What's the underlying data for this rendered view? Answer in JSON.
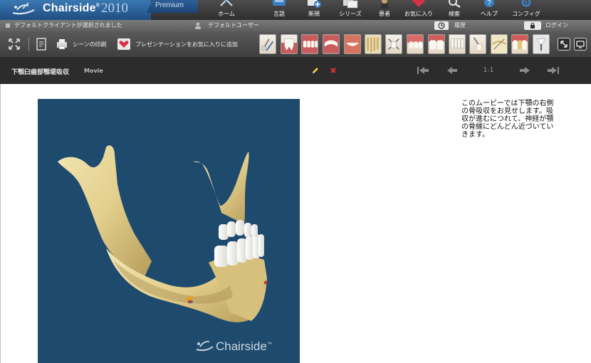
{
  "app": {
    "brand_name": "Chairside",
    "brand_mark": "®",
    "brand_year": "2010",
    "edition": "Premium",
    "nav": [
      {
        "label": "ホーム",
        "icon": "home-icon"
      },
      {
        "label": "言語",
        "icon": "language-icon"
      },
      {
        "label": "新規",
        "icon": "new-icon"
      },
      {
        "label": "シリーズ",
        "icon": "series-icon"
      },
      {
        "label": "患者",
        "icon": "patient-icon"
      },
      {
        "label": "お気に入り",
        "icon": "favorites-icon"
      },
      {
        "label": "検索",
        "icon": "search-icon"
      },
      {
        "label": "ヘルプ",
        "icon": "help-icon"
      },
      {
        "label": "コンフィグ",
        "icon": "config-icon"
      }
    ]
  },
  "status": {
    "client": "デフォルトクライアントが選択されました",
    "user": "デフォルトユーザー",
    "history": "履歴",
    "login": "ログイン"
  },
  "toolbar": {
    "print_label": "シーンの印刷",
    "favorite_label": "プレゼンテーションをお気に入りに追加"
  },
  "scene": {
    "title": "下顎臼歯部顎堤吸収",
    "kind": "Movie",
    "page": "1-1",
    "description": "このムービーでは下顎の右側の骨吸収をお見せします。吸収が進むにつれて、神経が顎の骨縁にどんどん近づいていきます。",
    "watermark_name": "Chairside",
    "watermark_mark": "™"
  },
  "colors": {
    "brand_blue": "#2a6399",
    "movie_background": "#1e4a6e",
    "bone": "#e8d79c",
    "toolbar_dark": "#3e3e3e"
  }
}
